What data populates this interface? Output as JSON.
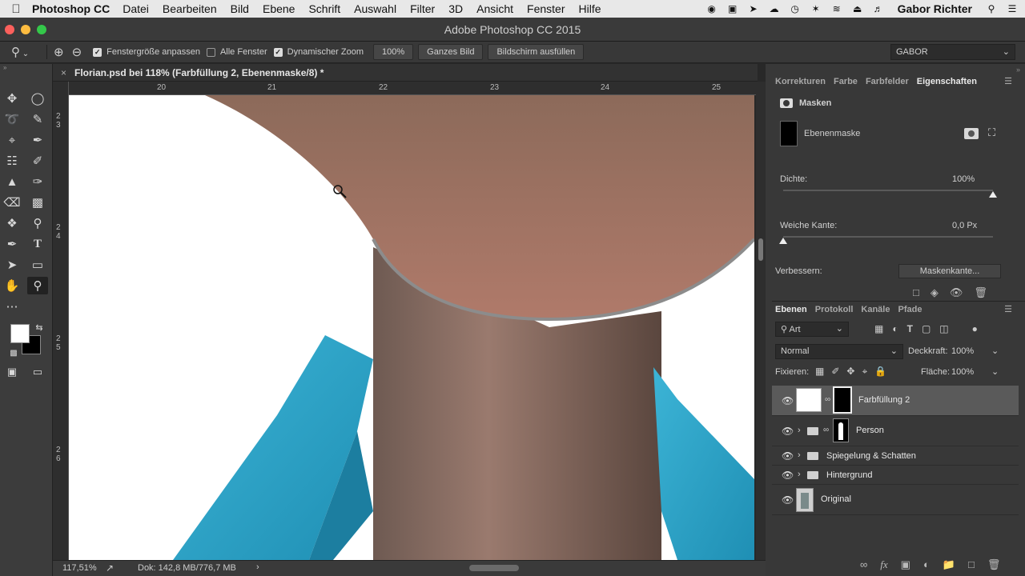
{
  "menubar": {
    "app_name": "Photoshop CC",
    "items": [
      "Datei",
      "Bearbeiten",
      "Bild",
      "Ebene",
      "Schrift",
      "Auswahl",
      "Filter",
      "3D",
      "Ansicht",
      "Fenster",
      "Hilfe"
    ],
    "user": "Gabor Richter"
  },
  "window": {
    "title": "Adobe Photoshop CC 2015",
    "traffic_colors": [
      "#fc605c",
      "#fdbc40",
      "#34c84a"
    ]
  },
  "options": {
    "fit_window": "Fenstergröße anpassen",
    "fit_window_checked": true,
    "all_windows": "Alle Fenster",
    "all_windows_checked": false,
    "scrubby_zoom": "Dynamischer Zoom",
    "scrubby_zoom_checked": true,
    "btn_100": "100%",
    "btn_fit": "Ganzes Bild",
    "btn_fill": "Bildschirm ausfüllen",
    "workspace": "GABOR"
  },
  "document": {
    "tab_title": "Florian.psd bei 118% (Farbfüllung 2, Ebenenmaske/8) *",
    "ruler_top": [
      "20",
      "21",
      "22",
      "23",
      "24",
      "25"
    ],
    "ruler_left": [
      "2\n3",
      "2\n4",
      "2\n5",
      "2\n6"
    ]
  },
  "status": {
    "zoom": "117,51%",
    "doc_info": "Dok: 142,8 MB/776,7 MB"
  },
  "properties_panel": {
    "tabs": [
      "Korrekturen",
      "Farbe",
      "Farbfelder",
      "Eigenschaften"
    ],
    "active_tab": "Eigenschaften",
    "section_title": "Masken",
    "mask_label": "Ebenenmaske",
    "density_label": "Dichte:",
    "density_value": "100%",
    "density_level": 1.0,
    "feather_label": "Weiche Kante:",
    "feather_value": "0,0 Px",
    "feather_level": 0.0,
    "refine_label": "Verbessern:",
    "refine_button": "Maskenkante..."
  },
  "layers_panel": {
    "tabs": [
      "Ebenen",
      "Protokoll",
      "Kanäle",
      "Pfade"
    ],
    "active_tab": "Ebenen",
    "kind_filter": "Art",
    "blend_mode": "Normal",
    "opacity_label": "Deckkraft:",
    "opacity_value": "100%",
    "lock_label": "Fixieren:",
    "fill_label": "Fläche:",
    "fill_value": "100%",
    "layers": [
      {
        "name": "Farbfüllung 2",
        "type": "fill",
        "selected": true
      },
      {
        "name": "Person",
        "type": "group-mask",
        "selected": false
      },
      {
        "name": "Spiegelung & Schatten",
        "type": "group",
        "selected": false
      },
      {
        "name": "Hintergrund",
        "type": "group",
        "selected": false
      },
      {
        "name": "Original",
        "type": "image",
        "selected": false
      }
    ]
  },
  "colors": {
    "shirt": "#2aa3c8",
    "skin": "#b07a6a",
    "foreground": "#ffffff",
    "background": "#000000"
  }
}
